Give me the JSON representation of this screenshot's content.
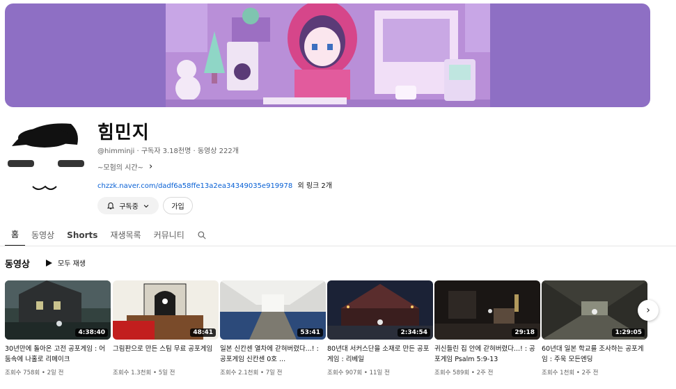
{
  "channel": {
    "name": "힘민지",
    "handle": "@himminji",
    "subscribers": "구독자 3.18천명",
    "video_count": "동영상 222개",
    "description": "~모험의 시간~",
    "link_url": "chzzk.naver.com/dadf6a58ffe13a2ea34349035e919978",
    "link_more": "외 링크 2개"
  },
  "buttons": {
    "subscribed_label": "구독중",
    "join_label": "가입"
  },
  "tabs": [
    {
      "label": "홈",
      "active": true
    },
    {
      "label": "동영상"
    },
    {
      "label": "Shorts"
    },
    {
      "label": "재생목록"
    },
    {
      "label": "커뮤니티"
    }
  ],
  "section": {
    "title": "동영상",
    "play_all": "모두 재생"
  },
  "videos": [
    {
      "title": "30년만에 돌아온 고전 공포게임 : 어둠속에 나홀로 리메이크",
      "duration": "4:38:40",
      "views": "조회수 758회",
      "age": "2일 전"
    },
    {
      "title": "그림판으로 만든 스팀 무료 공포게임",
      "duration": "48:41",
      "views": "조회수 1.3천회",
      "age": "5일 전"
    },
    {
      "title": "일본 신칸센 열차에 갇혀버렸다...! : 공포게임 신칸센 0호 ...",
      "duration": "53:41",
      "views": "조회수 2.1천회",
      "age": "7일 전"
    },
    {
      "title": "80년대 서커스단을 소재로 만든 공포게임 : 리베일",
      "duration": "2:34:54",
      "views": "조회수 907회",
      "age": "11일 전"
    },
    {
      "title": "귀신들린 집 안에 갇혀버렸다...! : 공포게임 Psalm 5:9-13",
      "duration": "29:18",
      "views": "조회수 589회",
      "age": "2주 전"
    },
    {
      "title": "60년대 일본 학교를 조사하는 공포게임 : 주욱 모든엔딩",
      "duration": "1:29:05",
      "views": "조회수 1천회",
      "age": "2주 전"
    }
  ]
}
